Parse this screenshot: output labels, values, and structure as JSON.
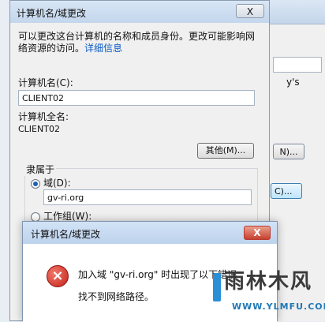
{
  "background_window": {
    "partial_text": "y's",
    "button1_label": "N)...",
    "button2_label": "C)..."
  },
  "dialog": {
    "title": "计算机名/域更改",
    "close_label": "X",
    "description": "可以更改这台计算机的名称和成员身份。更改可能影响网络资源的访问。",
    "details_link": "详细信息",
    "computer_name_label": "计算机名(C):",
    "computer_name_value": "CLIENT02",
    "full_name_label": "计算机全名:",
    "full_name_value": "CLIENT02",
    "other_button": "其他(M)...",
    "member_of_label": "隶属于",
    "domain_label": "域(D):",
    "domain_value": "gv-ri.org",
    "workgroup_label": "工作组(W):"
  },
  "error_dialog": {
    "title": "计算机名/域更改",
    "close_label": "X",
    "message_line1": "加入域 \"gv-ri.org\" 时出现了以下错误",
    "message_line2": "找不到网络路径。"
  },
  "watermark": {
    "text": "雨林木风",
    "url": "WWW.YLMFU.COM"
  }
}
